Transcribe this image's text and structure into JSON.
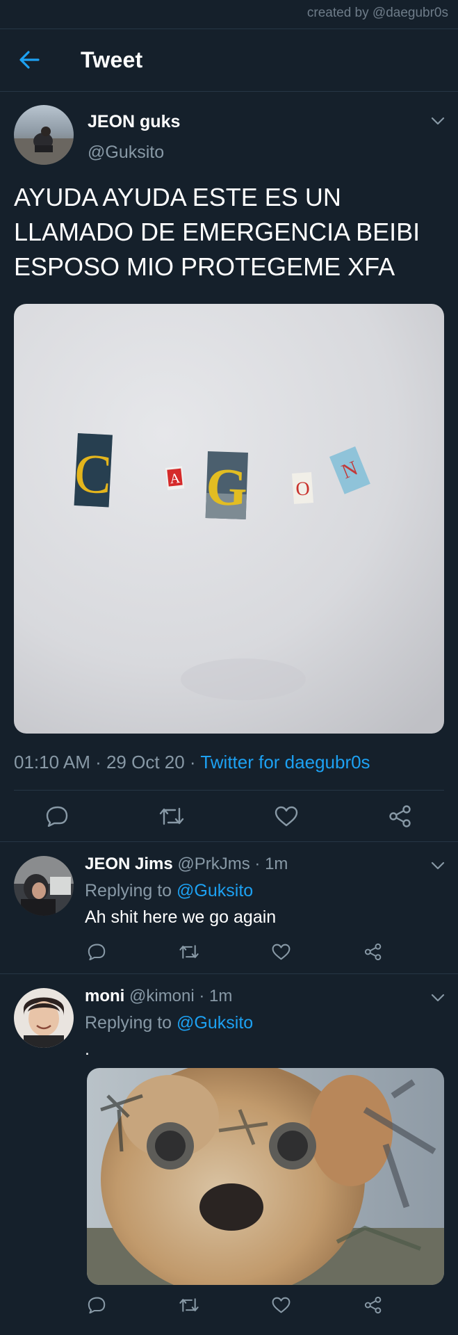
{
  "watermark": "created by @daegubr0s",
  "header": {
    "title": "Tweet",
    "back_icon": "arrow-left-icon"
  },
  "main_tweet": {
    "author_name": "JEON guks",
    "handle": "@Guksito",
    "text_lines": [
      "AYUDA AYUDA ESTE ES UN",
      "LLAMADO DE EMERGENCIA BEIBI",
      "ESPOSO MIO PROTEGEME XFA"
    ],
    "image_letters": [
      "C",
      "A",
      "G",
      "O",
      "N"
    ],
    "time": "01:10 AM · 29 Oct 20 · ",
    "source": "Twitter for daegubr0s"
  },
  "replies": [
    {
      "name": "JEON Jims",
      "handle_time": " @PrkJms · 1m",
      "replying_prefix": "Replying to ",
      "mention": "@Guksito",
      "text": "Ah shit here we go again"
    },
    {
      "name": "moni",
      "handle_time": " @kimoni · 1m",
      "replying_prefix": "Replying to ",
      "mention": "@Guksito",
      "text": "."
    }
  ],
  "colors": {
    "background": "#15202b",
    "accent": "#1da1f2",
    "muted": "#8899a6",
    "divider": "#263645"
  }
}
